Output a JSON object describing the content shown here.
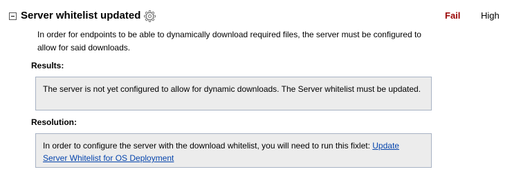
{
  "check": {
    "title": "Server whitelist updated",
    "status": "Fail",
    "severity": "High",
    "status_color": "#990000",
    "expanded": true,
    "description": "In order for endpoints to be able to dynamically download required files, the server must be configured to allow for said downloads."
  },
  "results": {
    "label": "Results:",
    "text": "The server is not yet configured to allow for dynamic downloads. The Server whitelist must be updated."
  },
  "resolution": {
    "label": "Resolution:",
    "text": "In order to configure the server with the download whitelist, you will need to run this fixlet: ",
    "link_text": "Update Server Whitelist for OS Deployment",
    "link_color": "#0645ad"
  },
  "icons": {
    "toggle": "collapse-minus-icon",
    "settings": "gear-icon"
  }
}
